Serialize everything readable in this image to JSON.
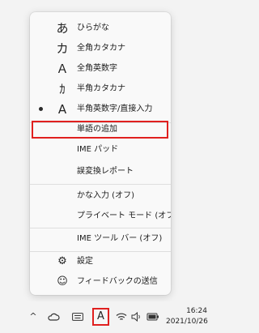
{
  "ime_menu": {
    "items": [
      {
        "glyph": "あ",
        "label": "ひらがな",
        "checked": false,
        "icon": "hiragana-icon"
      },
      {
        "glyph": "カ",
        "label": "全角カタカナ",
        "checked": false,
        "icon": "katakana-icon"
      },
      {
        "glyph": "Ａ",
        "label": "全角英数字",
        "checked": false,
        "icon": "fullwidth-alnum-icon"
      },
      {
        "glyph": "ｶ",
        "label": "半角カタカナ",
        "checked": false,
        "icon": "halfwidth-katakana-icon"
      },
      {
        "glyph": "A",
        "label": "半角英数字/直接入力",
        "checked": true,
        "icon": "halfwidth-alnum-icon"
      }
    ],
    "tools": [
      {
        "label": "単語の追加",
        "highlighted": true
      },
      {
        "label": "IME パッド"
      },
      {
        "label": "誤変換レポート"
      }
    ],
    "options": [
      {
        "label": "かな入力 (オフ)"
      },
      {
        "label": "プライベート モード (オフ)"
      },
      {
        "label": "IME ツール バー (オフ)"
      }
    ],
    "footer": [
      {
        "glyph": "⚙",
        "label": "設定",
        "icon": "gear-icon"
      },
      {
        "glyph": "☺",
        "label": "フィードバックの送信",
        "icon": "feedback-icon"
      }
    ]
  },
  "taskbar": {
    "chevron": "^",
    "ime_indicator": "A",
    "time": "16:24",
    "date": "2021/10/26"
  },
  "colors": {
    "highlight_border": "#e0201f",
    "menu_bg": "#f9f9f9"
  }
}
